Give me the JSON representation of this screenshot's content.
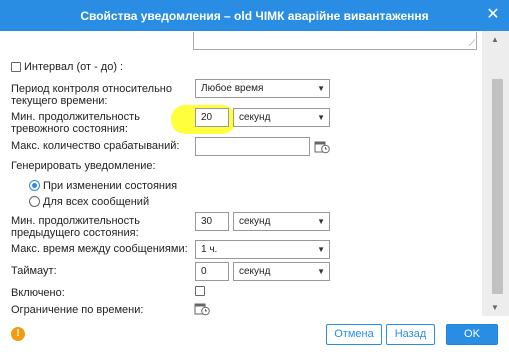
{
  "window": {
    "title": "Свойства уведомления – old ЧІМК аварійне вивантаження",
    "close_icon": "close-icon"
  },
  "form": {
    "interval_label": "Интервал (от - до) :",
    "control_period_label": "Период контроля относительно текущего времени:",
    "control_period_value": "Любое время",
    "min_alarm_duration_label": "Мин. продолжительность тревожного состояния:",
    "min_alarm_duration_value": "20",
    "min_alarm_duration_unit": "секунд",
    "max_triggers_label": "Макс. количество срабатываний:",
    "max_triggers_value": "",
    "generate_label": "Генерировать уведомление:",
    "generate_options": [
      "При изменении состояния",
      "Для всех сообщений"
    ],
    "generate_selected": 0,
    "min_prev_duration_label": "Мин. продолжительность предыдущего состояния:",
    "min_prev_duration_value": "30",
    "min_prev_duration_unit": "секунд",
    "max_time_between_label": "Макс. время между сообщениями:",
    "max_time_between_value": "1 ч.",
    "timeout_label": "Таймаут:",
    "timeout_value": "0",
    "timeout_unit": "секунд",
    "enabled_label": "Включено:",
    "time_limit_label": "Ограничение по времени:"
  },
  "footer": {
    "cancel_label": "Отмена",
    "back_label": "Назад",
    "ok_label": "OK"
  },
  "colors": {
    "accent": "#2a8de4",
    "highlight": "#ffff33",
    "warning": "#f39c12"
  }
}
